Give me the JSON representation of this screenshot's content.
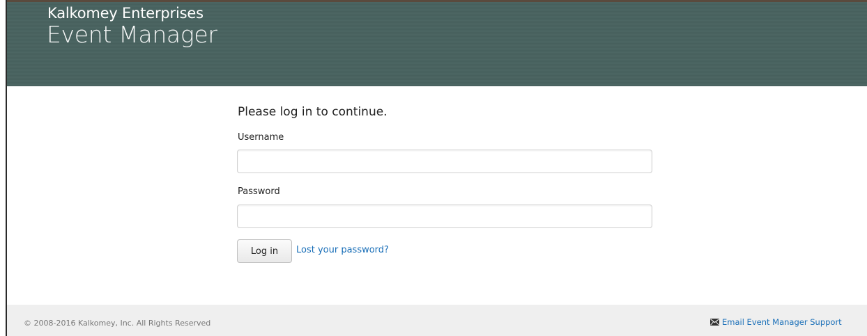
{
  "header": {
    "company_name": "Kalkomey Enterprises",
    "app_name": "Event Manager",
    "background_color": "#48625f"
  },
  "login": {
    "prompt": "Please log in to continue.",
    "username_label": "Username",
    "username_value": "",
    "password_label": "Password",
    "password_value": "",
    "submit_label": "Log in",
    "lost_password_link": "Lost your password?"
  },
  "footer": {
    "copyright": "© 2008-2016 Kalkomey, Inc. All Rights Reserved",
    "support_link": "Email Event Manager Support",
    "support_icon": "envelope-icon",
    "link_color": "#1a6fb8"
  }
}
